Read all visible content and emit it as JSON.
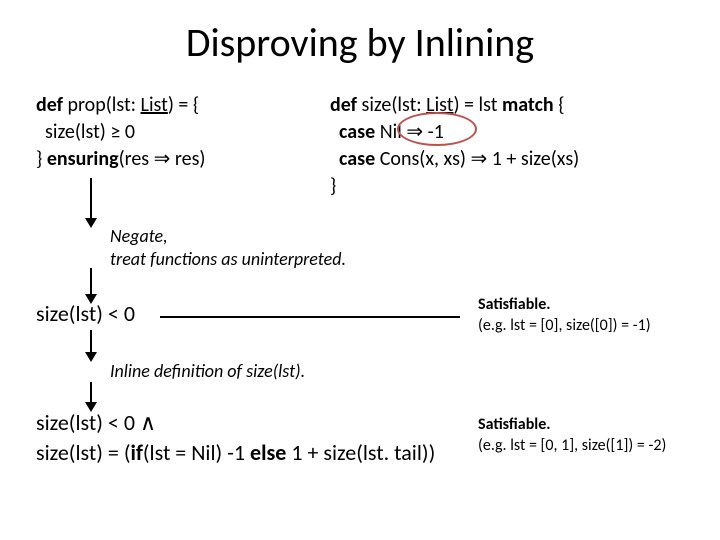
{
  "title": "Disproving by Inlining",
  "code_left": {
    "def": "def",
    "prop_sig_pre": " prop(lst: ",
    "list_type": "List",
    "prop_sig_post": ") = {",
    "body1": "  size(lst) ≥ 0",
    "close_brace": "} ",
    "ensuring_kw": "ensuring",
    "ensuring_args": "(res ⇒ res)"
  },
  "code_right": {
    "def": "def",
    "size_sig_pre": " size(lst: ",
    "list_type": "List",
    "size_sig_post": ") = lst ",
    "match_kw": "match",
    "brace_open": " {",
    "case1_kw": "  case",
    "case1_body": " Nil ⇒ -1",
    "case2_kw": "  case",
    "case2_body": " Cons(x, xs) ⇒ 1 + size(xs)",
    "close": "}"
  },
  "note1_line1": "Negate,",
  "note1_line2": "treat functions as uninterpreted.",
  "row_size_text": "size(lst) < 0",
  "sat1_head": "Satisfiable.",
  "sat1_body": "(e.g. lst = [0], size([0]) = -1)",
  "note2": "Inline definition of size(lst).",
  "row2_line1_pre": "size(lst) < 0 ",
  "row2_and": "∧",
  "row2_line2_pre": "size(lst) = (",
  "row2_if": "if",
  "row2_line2_mid": "(lst = Nil) -1 ",
  "row2_else": "else",
  "row2_line2_post": " 1 + size(lst. tail))",
  "sat2_head": "Satisfiable.",
  "sat2_body": "(e.g. lst = [0, 1], size([1]) = -2)"
}
